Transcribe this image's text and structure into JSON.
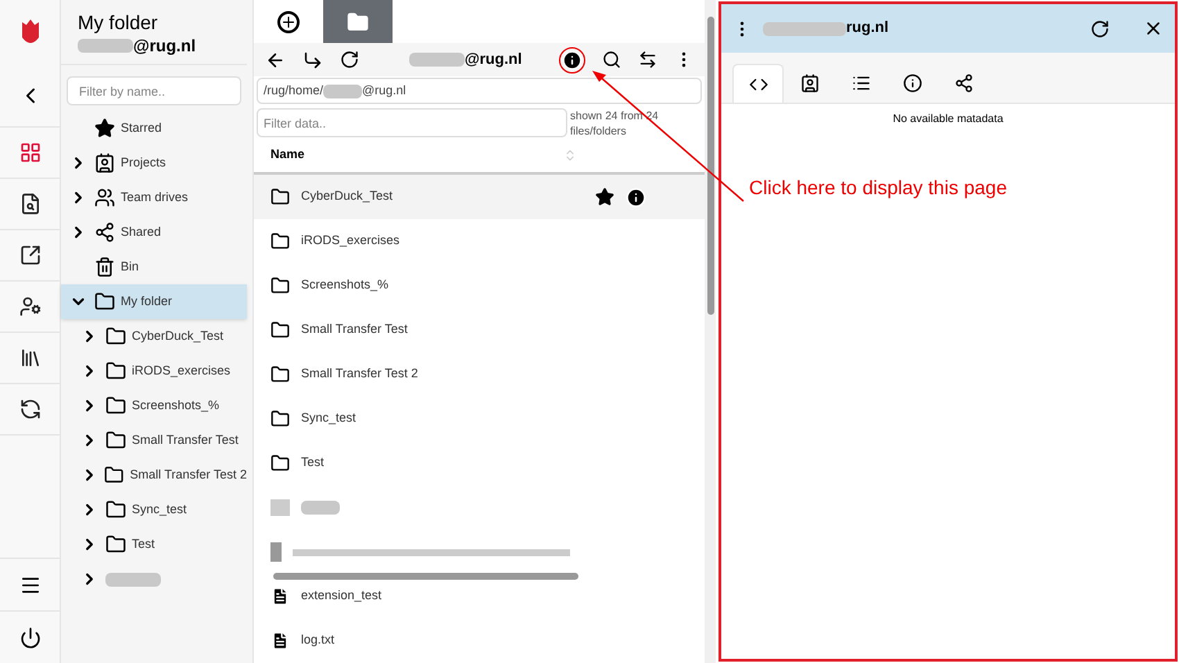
{
  "nav_rail": {
    "items": [
      {
        "selected": true
      },
      {
        "selected": false
      },
      {
        "selected": false
      },
      {
        "selected": false
      },
      {
        "selected": false
      },
      {
        "selected": false
      }
    ]
  },
  "tree": {
    "title": "My folder",
    "user": "@rug.nl",
    "filter": {
      "placeholder": "Filter by name.."
    },
    "items": [
      {
        "kind": "star",
        "label": "Starred"
      },
      {
        "kind": "projects",
        "label": "Projects",
        "expanded": false
      },
      {
        "kind": "team",
        "label": "Team drives",
        "expanded": false
      },
      {
        "kind": "shared",
        "label": "Shared",
        "expanded": false
      },
      {
        "kind": "bin",
        "label": "Bin"
      },
      {
        "kind": "folder",
        "label": "My folder",
        "expanded": true,
        "selected": true,
        "children": [
          {
            "kind": "folder",
            "label": "CyberDuck_Test",
            "expanded": false,
            "selected": false
          },
          {
            "kind": "folder",
            "label": "iRODS_exercises",
            "expanded": false,
            "selected": false
          },
          {
            "kind": "folder",
            "label": "Screenshots_%",
            "expanded": false,
            "selected": false
          },
          {
            "kind": "folder",
            "label": "Small Transfer Test",
            "expanded": false,
            "selected": false
          },
          {
            "kind": "folder",
            "label": "Small Transfer Test 2",
            "expanded": false,
            "selected": false
          },
          {
            "kind": "folder",
            "label": "Sync_test",
            "expanded": false,
            "selected": false
          },
          {
            "kind": "folder",
            "label": "Test",
            "expanded": false,
            "selected": false
          },
          {
            "kind": "redacted",
            "expanded": false,
            "selected": false
          }
        ]
      }
    ]
  },
  "browser": {
    "tabs": [
      {
        "kind": "add",
        "selected": false
      },
      {
        "kind": "folder",
        "selected": true
      }
    ],
    "title": "@rug.nl",
    "path_prefix": "/rug/home/",
    "path_suffix": "@rug.nl",
    "filter": {
      "placeholder": "Filter data.."
    },
    "count": "shown 24 from 24 files/folders",
    "table": {
      "columns": [
        "Name"
      ],
      "rows": [
        {
          "kind": "folder",
          "name": "CyberDuck_Test",
          "selected": true
        },
        {
          "kind": "folder",
          "name": "iRODS_exercises",
          "selected": false
        },
        {
          "kind": "folder",
          "name": "Screenshots_%",
          "selected": false
        },
        {
          "kind": "folder",
          "name": "Small Transfer Test",
          "selected": false
        },
        {
          "kind": "folder",
          "name": "Small Transfer Test 2",
          "selected": false
        },
        {
          "kind": "folder",
          "name": "Sync_test",
          "selected": false
        },
        {
          "kind": "folder",
          "name": "Test",
          "selected": false
        },
        {
          "kind": "redacted-folder",
          "selected": false
        },
        {
          "kind": "redacted-file",
          "selected": false
        },
        {
          "kind": "file",
          "name": "extension_test",
          "selected": false
        },
        {
          "kind": "file",
          "name": "log.txt",
          "selected": false
        }
      ]
    }
  },
  "details": {
    "title": "rug.nl",
    "tabs": [
      {
        "kind": "code",
        "selected": true
      },
      {
        "kind": "card",
        "selected": false
      },
      {
        "kind": "list",
        "selected": false
      },
      {
        "kind": "info",
        "selected": false
      },
      {
        "kind": "share",
        "selected": false
      }
    ],
    "message": "No available matadata"
  },
  "annotation": {
    "text": "Click here to display this page"
  }
}
